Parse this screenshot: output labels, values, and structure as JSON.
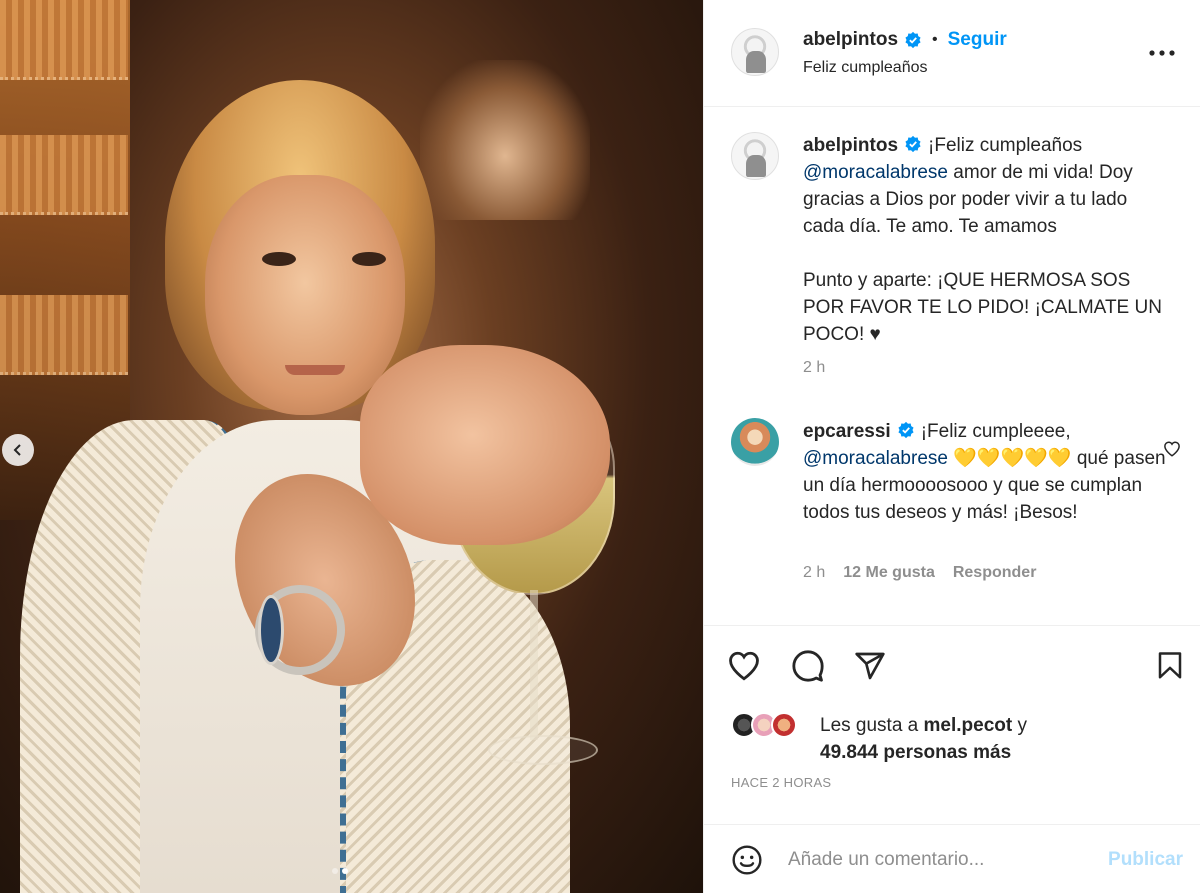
{
  "header": {
    "username": "abelpintos",
    "separator": "•",
    "follow_label": "Seguir",
    "subtitle": "Feliz cumpleaños"
  },
  "caption": {
    "username": "abelpintos",
    "text_1": "¡Feliz cumpleaños",
    "mention": "@moracalabrese",
    "text_2": "amor de mi vida! Doy gracias a Dios por poder vivir a tu lado cada día. Te amo. Te amamos",
    "text_3": "Punto y aparte: ¡QUE HERMOSA SOS POR FAVOR TE LO PIDO! ¡CALMATE UN POCO! ♥",
    "time": "2 h"
  },
  "comment": {
    "username": "epcaressi",
    "text_1": "¡Feliz cumpleeee,",
    "mention": "@moracalabrese",
    "emojis": "💛💛💛💛💛",
    "text_2": "qué pasen un día hermoooosooo y que se cumplan todos tus deseos y más! ¡Besos!",
    "time": "2 h",
    "likes": "12 Me gusta",
    "reply_label": "Responder"
  },
  "likes": {
    "prefix": "Les gusta a",
    "user": "mel.pecot",
    "joiner": "y",
    "count": "49.844 personas más"
  },
  "timestamp": "HACE 2 HORAS",
  "add_comment": {
    "placeholder": "Añade un comentario...",
    "publish_label": "Publicar"
  },
  "carousel": {
    "total": 2,
    "active": 2
  },
  "colors": {
    "link": "#0095f6",
    "verified": "#0095f6",
    "mention": "#00376b",
    "publish_disabled": "#b2dffc",
    "muted": "#8e8e8e"
  }
}
